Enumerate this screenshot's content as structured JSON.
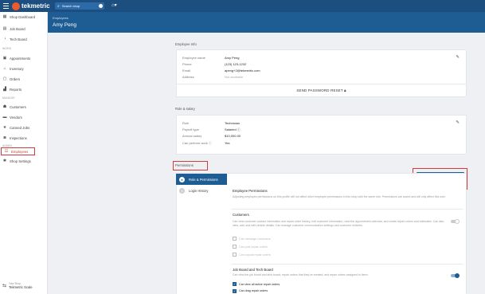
{
  "topbar": {
    "logo_text": "tekmetric",
    "search_label": "Search shop"
  },
  "sidebar": {
    "sections": {
      "work": "WORK",
      "manage": "MANAGE",
      "admin": "ADMIN"
    },
    "items": [
      {
        "label": "Shop Dashboard",
        "icon": "dashboard-icon",
        "glyph": "▦"
      },
      {
        "label": "Job Board",
        "icon": "job-board-icon",
        "glyph": "▤"
      },
      {
        "label": "Tech Board",
        "icon": "tech-board-icon",
        "glyph": "◔"
      },
      {
        "label": "Appointments",
        "icon": "calendar-icon",
        "glyph": "▣"
      },
      {
        "label": "Inventory",
        "icon": "inventory-icon",
        "glyph": "⌂"
      },
      {
        "label": "Orders",
        "icon": "orders-icon",
        "glyph": "▢"
      },
      {
        "label": "Reports",
        "icon": "reports-icon",
        "glyph": "▟"
      },
      {
        "label": "Customers",
        "icon": "customers-icon",
        "glyph": "☗"
      },
      {
        "label": "Vendors",
        "icon": "vendors-icon",
        "glyph": "▬"
      },
      {
        "label": "Canned Jobs",
        "icon": "star-icon",
        "glyph": "★"
      },
      {
        "label": "Inspections",
        "icon": "inspections-icon",
        "glyph": "◙"
      },
      {
        "label": "Employees",
        "icon": "employees-icon",
        "glyph": "☷"
      },
      {
        "label": "Shop Settings",
        "icon": "gear-icon",
        "glyph": "✱"
      }
    ],
    "shop_footer": {
      "small": "Your Shop",
      "name": "Tekmetric Scale"
    }
  },
  "header": {
    "breadcrumb": "Employees",
    "employee_name": "Amy Peng"
  },
  "employee_info": {
    "section_label": "Employee Info",
    "fields": [
      {
        "key": "Employee name",
        "value": "Amy Peng"
      },
      {
        "key": "Phone",
        "value": "(123) 123-1232"
      },
      {
        "key": "Email",
        "value": "apeng+2@tekmetric.com"
      },
      {
        "key": "Address",
        "value": "Not available"
      }
    ],
    "reset_label": "SEND PASSWORD RESET"
  },
  "role_salary": {
    "section_label": "Role & salary",
    "fields": [
      {
        "key": "Role",
        "value": "Technician"
      },
      {
        "key": "Payroll type",
        "value": "Salaried"
      },
      {
        "key": "Annual salary",
        "value": "$10,000.00"
      },
      {
        "key": "Can perform work",
        "value": "Yes"
      }
    ]
  },
  "permissions": {
    "section_label": "Permissions",
    "save_label": "SAVE PERMISSIONS",
    "tabs": [
      {
        "label": "Role & Permissions"
      },
      {
        "label": "Login History"
      }
    ],
    "employee_permissions": {
      "title": "Employee Permissions",
      "desc": "Adjusting employee permissions on this profile will not affect other employee permissions in this shop with the same role. Permissions are saved and will only affect this user."
    },
    "customers": {
      "title": "Customers",
      "toggle": "off",
      "desc": "Can view customer contact information and repair order history, edit customer information, view the appointment calendar, and create repair orders and estimates. Can also view, add, and edit vehicle details. Can manage customer communication settings and customer vehicles.",
      "options": [
        {
          "label": "Can message customers",
          "checked": false
        },
        {
          "label": "Can post repair orders",
          "checked": false
        },
        {
          "label": "Can unpost repair orders",
          "checked": false
        }
      ]
    },
    "job_board": {
      "title": "Job Board and Tech Board",
      "toggle": "on",
      "desc": "Can view the job board and tech board; repair orders that they've created; and repair orders assigned to them.",
      "options": [
        {
          "label": "Can view all active repair orders",
          "checked": true
        },
        {
          "label": "Can drag repair orders",
          "checked": true
        }
      ]
    }
  }
}
